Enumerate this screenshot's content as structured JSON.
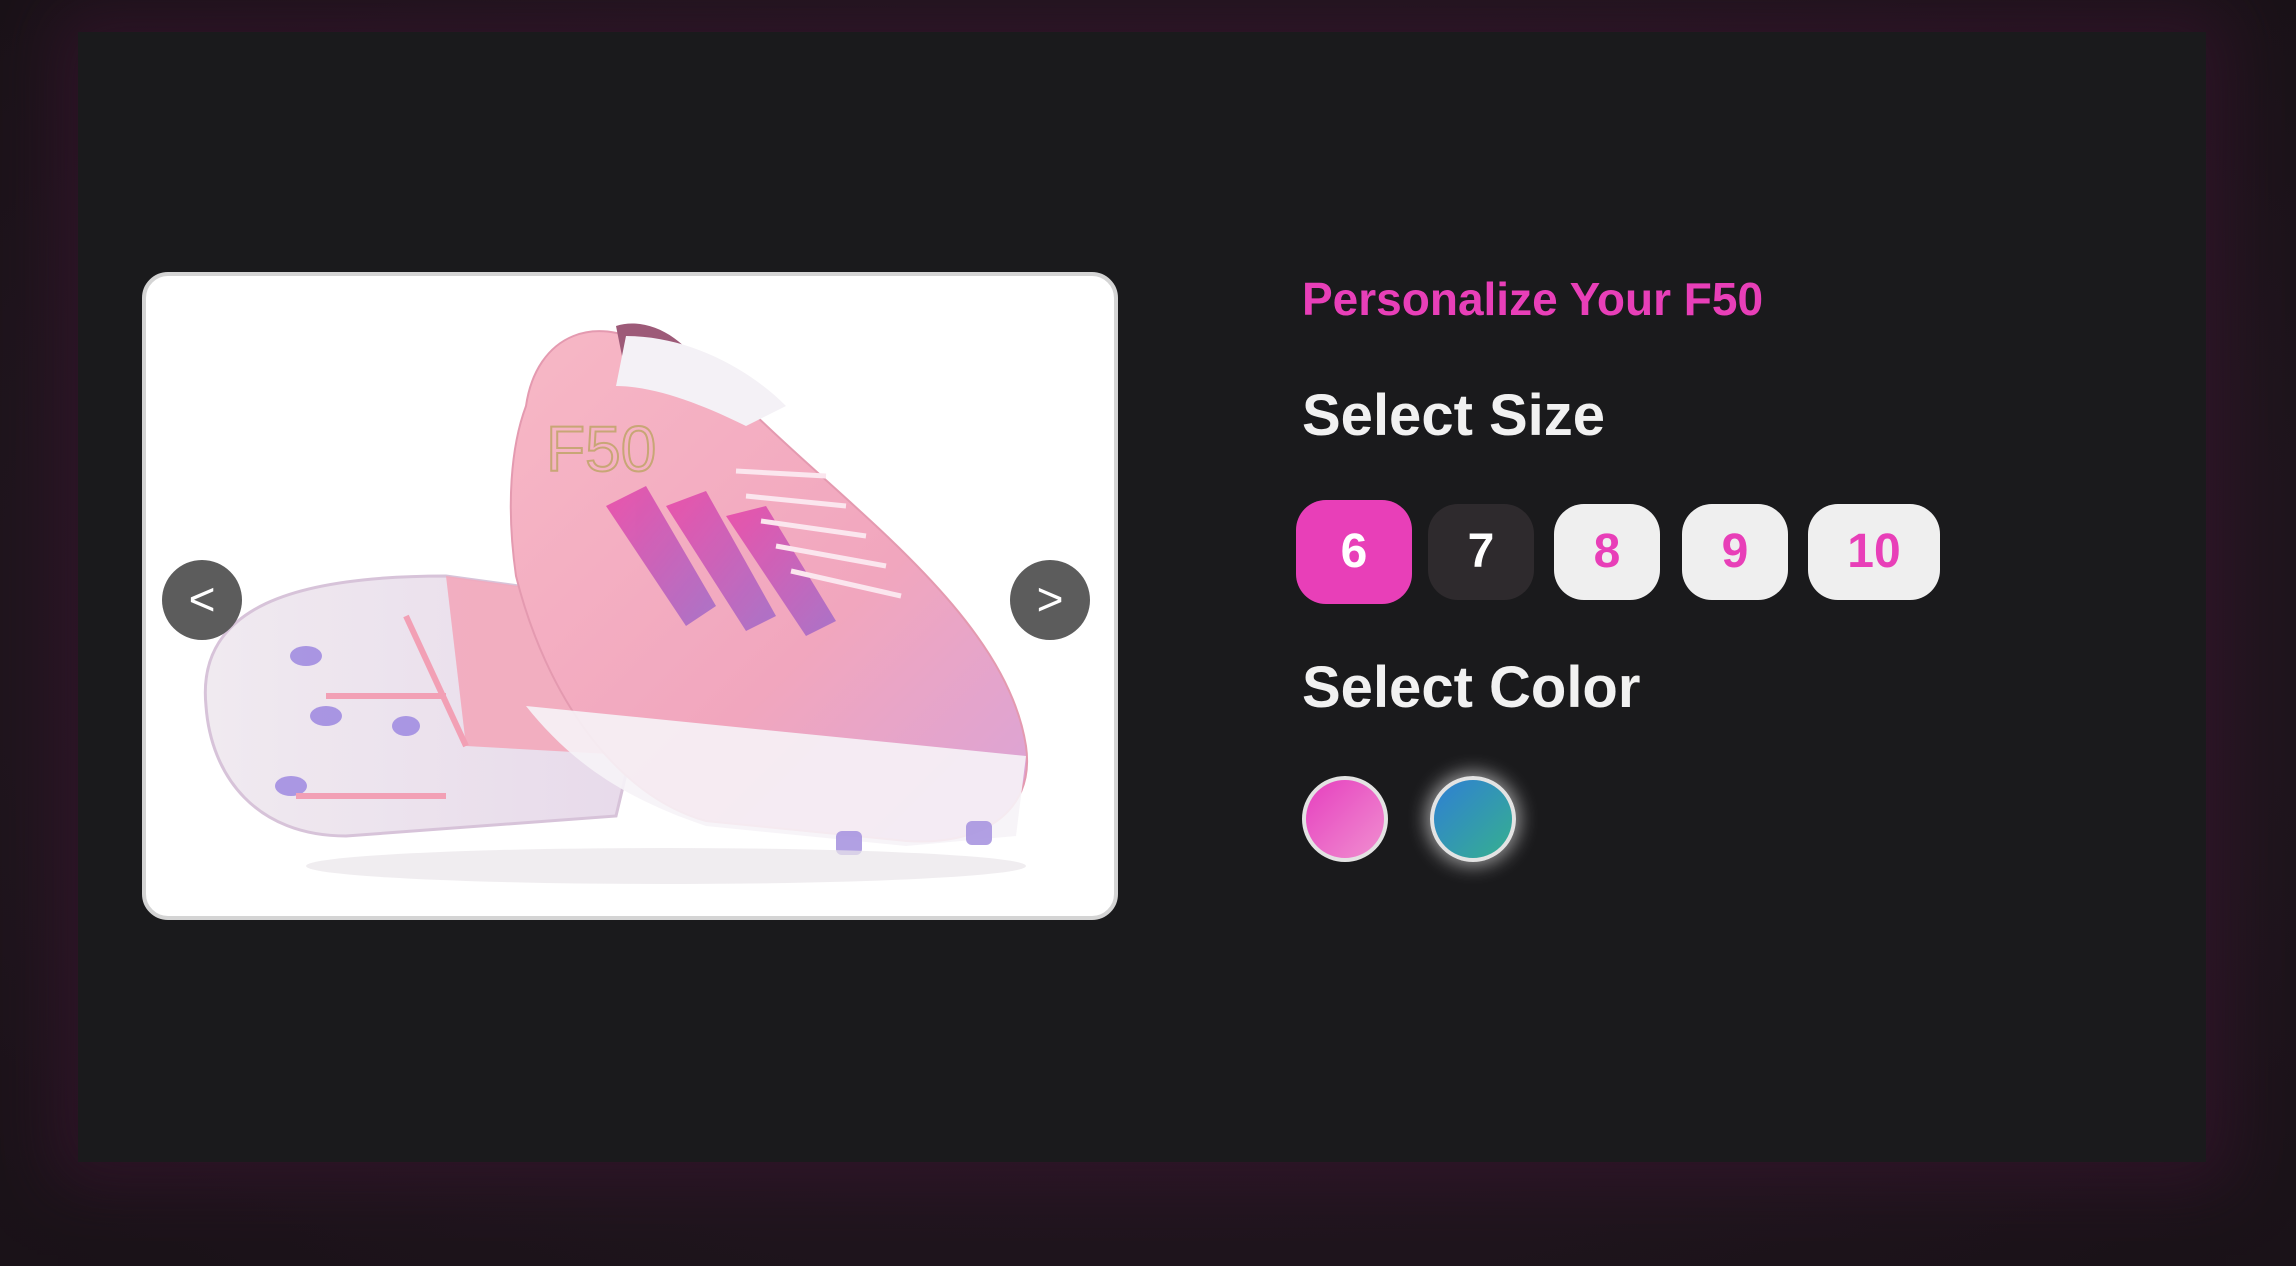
{
  "product": {
    "heading": "Personalize Your F50",
    "image_alt": "pink-football-boot-photo"
  },
  "carousel": {
    "prev_label": "<",
    "next_label": ">"
  },
  "size_section": {
    "title": "Select Size",
    "options": [
      "6",
      "7",
      "8",
      "9",
      "10"
    ],
    "selected": "6"
  },
  "color_section": {
    "title": "Select Color",
    "swatches": [
      {
        "name": "pink",
        "from": "#e63fbf",
        "to": "#f08fd0"
      },
      {
        "name": "blue-green",
        "from": "#2f7fd4",
        "to": "#36b08f"
      }
    ]
  },
  "theme": {
    "accent": "#e83fb8",
    "panel_bg": "#1a1a1c"
  }
}
